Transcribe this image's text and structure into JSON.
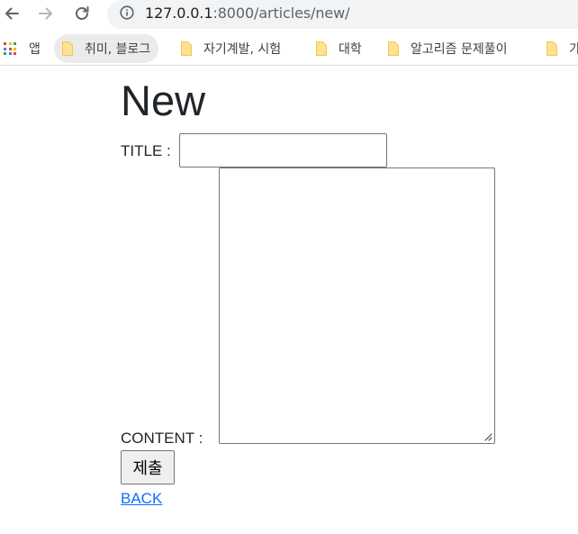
{
  "browser": {
    "url_host": "127.0.0.1",
    "url_rest": ":8000/articles/new/"
  },
  "bookmarks": {
    "apps_label": "앱",
    "items": [
      {
        "label": "취미, 블로그",
        "icon": "folder-icon"
      },
      {
        "label": "자기계발, 시험",
        "icon": "folder-icon"
      },
      {
        "label": "대학",
        "icon": "folder-icon"
      },
      {
        "label": "알고리즘 문제풀이",
        "icon": "folder-icon"
      },
      {
        "label": "가",
        "icon": "folder-icon"
      }
    ]
  },
  "page": {
    "heading": "New",
    "form": {
      "title_label": "TITLE :",
      "title_value": "",
      "content_label": "CONTENT :",
      "content_value": "",
      "submit_label": "제출"
    },
    "back_link": "BACK"
  },
  "colors": {
    "link": "#0d6efd",
    "folder_fill": "#fde293",
    "folder_stroke": "#f2c94c"
  }
}
